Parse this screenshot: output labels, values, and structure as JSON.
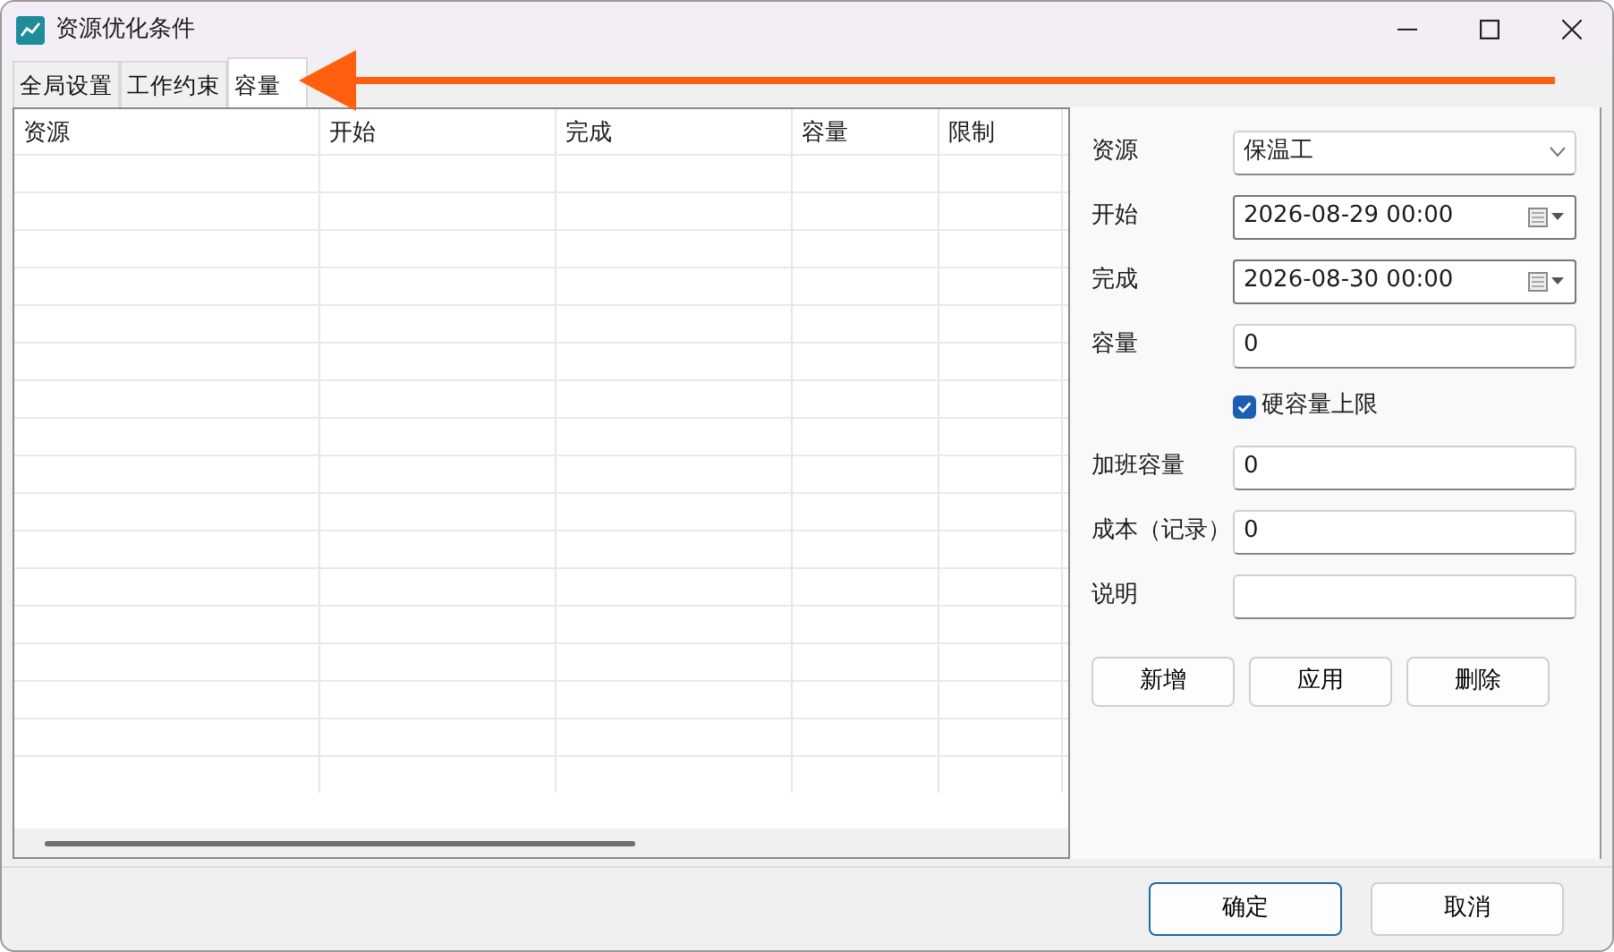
{
  "window": {
    "title": "资源优化条件"
  },
  "tabs": [
    {
      "label": "全局设置",
      "selected": false
    },
    {
      "label": "工作约束",
      "selected": false
    },
    {
      "label": "容量",
      "selected": true
    }
  ],
  "table": {
    "columns": [
      "资源",
      "开始",
      "完成",
      "容量",
      "限制"
    ]
  },
  "form": {
    "fields": [
      {
        "kind": "select",
        "label": "资源",
        "value": "保温工"
      },
      {
        "kind": "datetime",
        "label": "开始",
        "value": "2026-08-29 00:00"
      },
      {
        "kind": "datetime",
        "label": "完成",
        "value": "2026-08-30 00:00"
      },
      {
        "kind": "text",
        "label": "容量",
        "value": "0"
      },
      {
        "kind": "checkbox",
        "label": "硬容量上限",
        "checked": true
      },
      {
        "kind": "text",
        "label": "加班容量",
        "value": "0"
      },
      {
        "kind": "text",
        "label": "成本（记录）",
        "value": "0"
      },
      {
        "kind": "text",
        "label": "说明"
      }
    ],
    "actions": [
      "新增",
      "应用",
      "删除"
    ]
  },
  "buttons": [
    {
      "label": "确定",
      "default": true
    },
    {
      "label": "取消",
      "default": false
    }
  ]
}
